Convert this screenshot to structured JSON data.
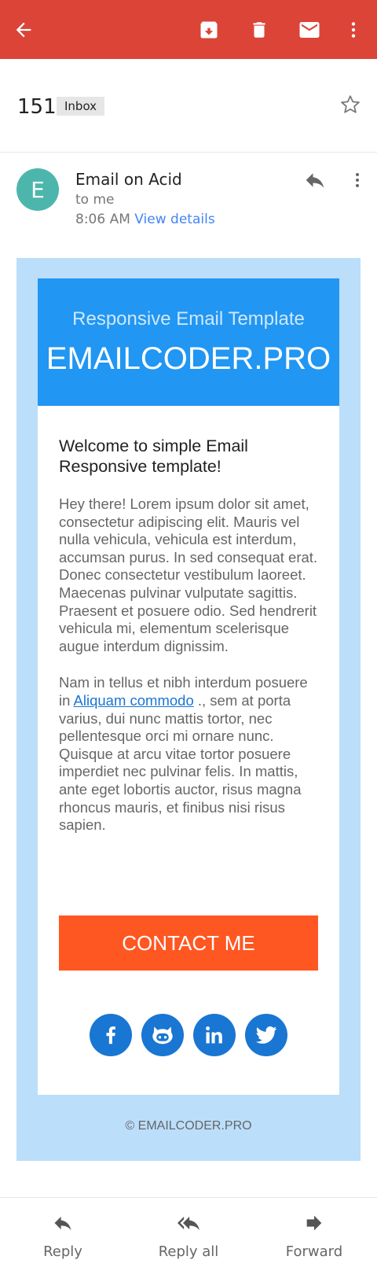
{
  "toolbar": {
    "bg_color": "#db4437",
    "icons": [
      "back-arrow-icon",
      "archive-icon",
      "delete-icon",
      "mark-unread-icon",
      "more-vert-icon"
    ]
  },
  "subject": {
    "count": "151",
    "badge": "Inbox"
  },
  "message": {
    "sender_initial": "E",
    "sender_name": "Email on Acid",
    "recipient": "to me",
    "time": "8:06 AM",
    "view_details": "View details",
    "avatar_color": "#4db6ac"
  },
  "email": {
    "outer_bg": "#bbdefb",
    "hero_bg": "#2196f3",
    "hero_subtitle": "Responsive Email Template",
    "hero_title": "EMAILCODER.PRO",
    "heading": "Welcome to simple Email Responsive template!",
    "paragraph1": "Hey there! Lorem ipsum dolor sit amet, consectetur adipiscing elit. Mauris vel nulla vehicula, vehicula est interdum, accumsan purus. In sed consequat erat. Donec consectetur vestibulum laoreet. Maecenas pulvinar vulputate sagittis. Praesent et posuere odio. Sed hendrerit vehicula mi, elementum scelerisque augue interdum dignissim.",
    "paragraph2_before": "Nam in tellus et nibh interdum posuere in ",
    "paragraph2_link": "Aliquam commodo",
    "paragraph2_after": " ., sem at porta varius, dui nunc mattis tortor, nec pellentesque orci mi ornare nunc. Quisque at arcu vitae tortor posuere imperdiet nec pulvinar felis. In mattis, ante eget lobortis auctor, risus magna rhoncus mauris, et finibus nisi risus sapien.",
    "cta_label": "CONTACT ME",
    "cta_color": "#ff5722",
    "social_icons": [
      "facebook-icon",
      "github-icon",
      "linkedin-icon",
      "twitter-icon"
    ],
    "copyright": "© EMAILCODER.PRO"
  },
  "actions": {
    "reply": "Reply",
    "reply_all": "Reply all",
    "forward": "Forward"
  }
}
